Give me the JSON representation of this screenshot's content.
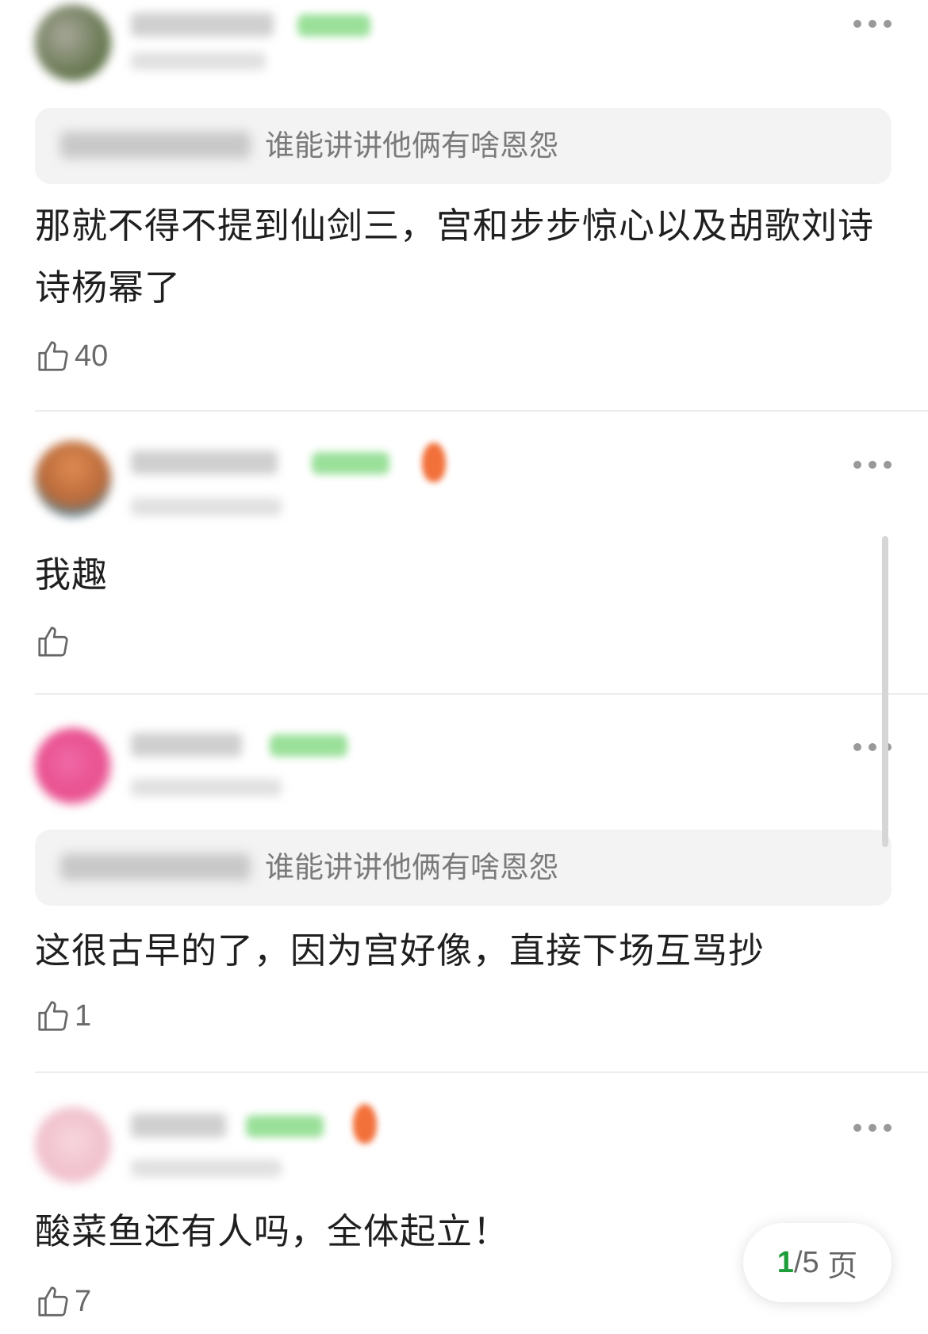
{
  "comments": [
    {
      "quote": "谁能讲讲他俩有啥恩怨",
      "text": "那就不得不提到仙剑三，宫和步步惊心以及胡歌刘诗诗杨幂了",
      "likes": "40"
    },
    {
      "text": "我趣",
      "likes": ""
    },
    {
      "quote": "谁能讲讲他俩有啥恩怨",
      "text": "这很古早的了，因为宫好像，直接下场互骂抄",
      "likes": "1"
    },
    {
      "text": "酸菜鱼还有人吗，全体起立！",
      "likes": "7"
    }
  ],
  "pager": {
    "current": "1",
    "separator": "/",
    "total": "5",
    "unit": " 页"
  },
  "colors": {
    "accent_green": "#1e9e3a",
    "quote_bg": "#f3f3f3"
  }
}
